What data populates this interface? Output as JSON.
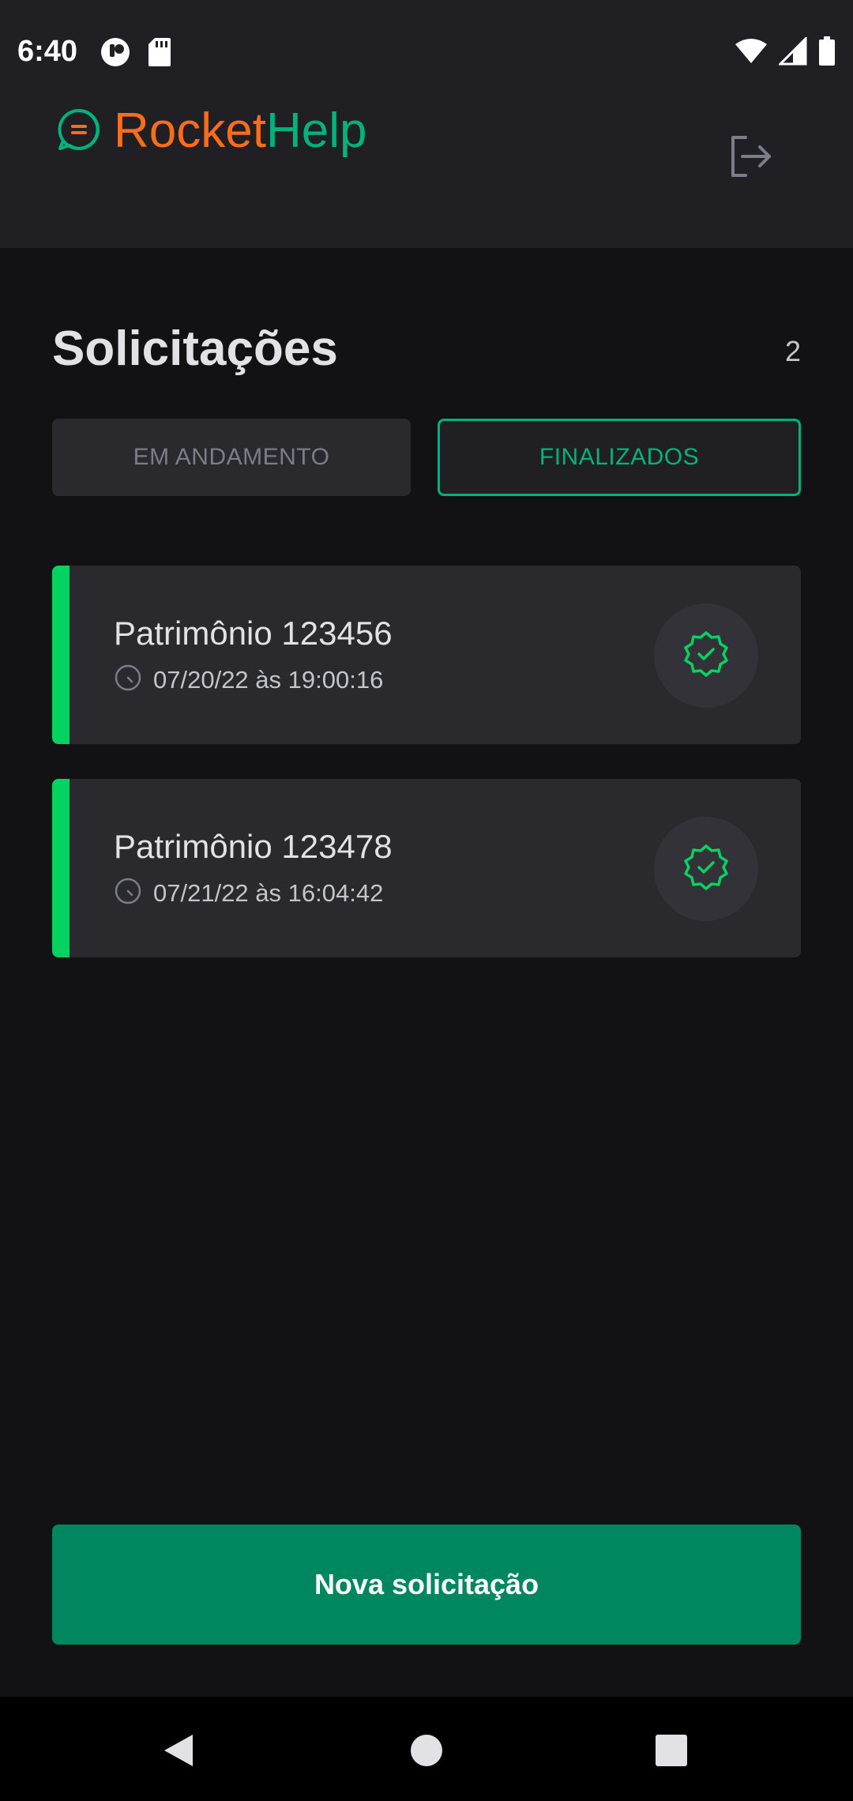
{
  "status_bar": {
    "time": "6:40"
  },
  "header": {
    "brand_part1": "Rocket",
    "brand_part2": "Help",
    "brand_colors": {
      "rocket": "#fb6d1a",
      "help": "#00b37e"
    },
    "logout_icon": "logout-icon"
  },
  "main": {
    "title": "Solicitações",
    "count": "2",
    "tabs": [
      {
        "label": "EM ANDAMENTO",
        "selected": false
      },
      {
        "label": "FINALIZADOS",
        "selected": true
      }
    ],
    "requests": [
      {
        "title": "Patrimônio 123456",
        "date": "07/20/22 às 19:00:16",
        "status_icon": "check-badge-icon",
        "status_color": "#04d361"
      },
      {
        "title": "Patrimônio 123478",
        "date": "07/21/22 às 16:04:42",
        "status_icon": "check-badge-icon",
        "status_color": "#04d361"
      }
    ],
    "new_request_label": "Nova solicitação"
  },
  "colors": {
    "accent": "#00b37e",
    "button": "#00875f",
    "background": "#121214",
    "surface": "#202024"
  }
}
